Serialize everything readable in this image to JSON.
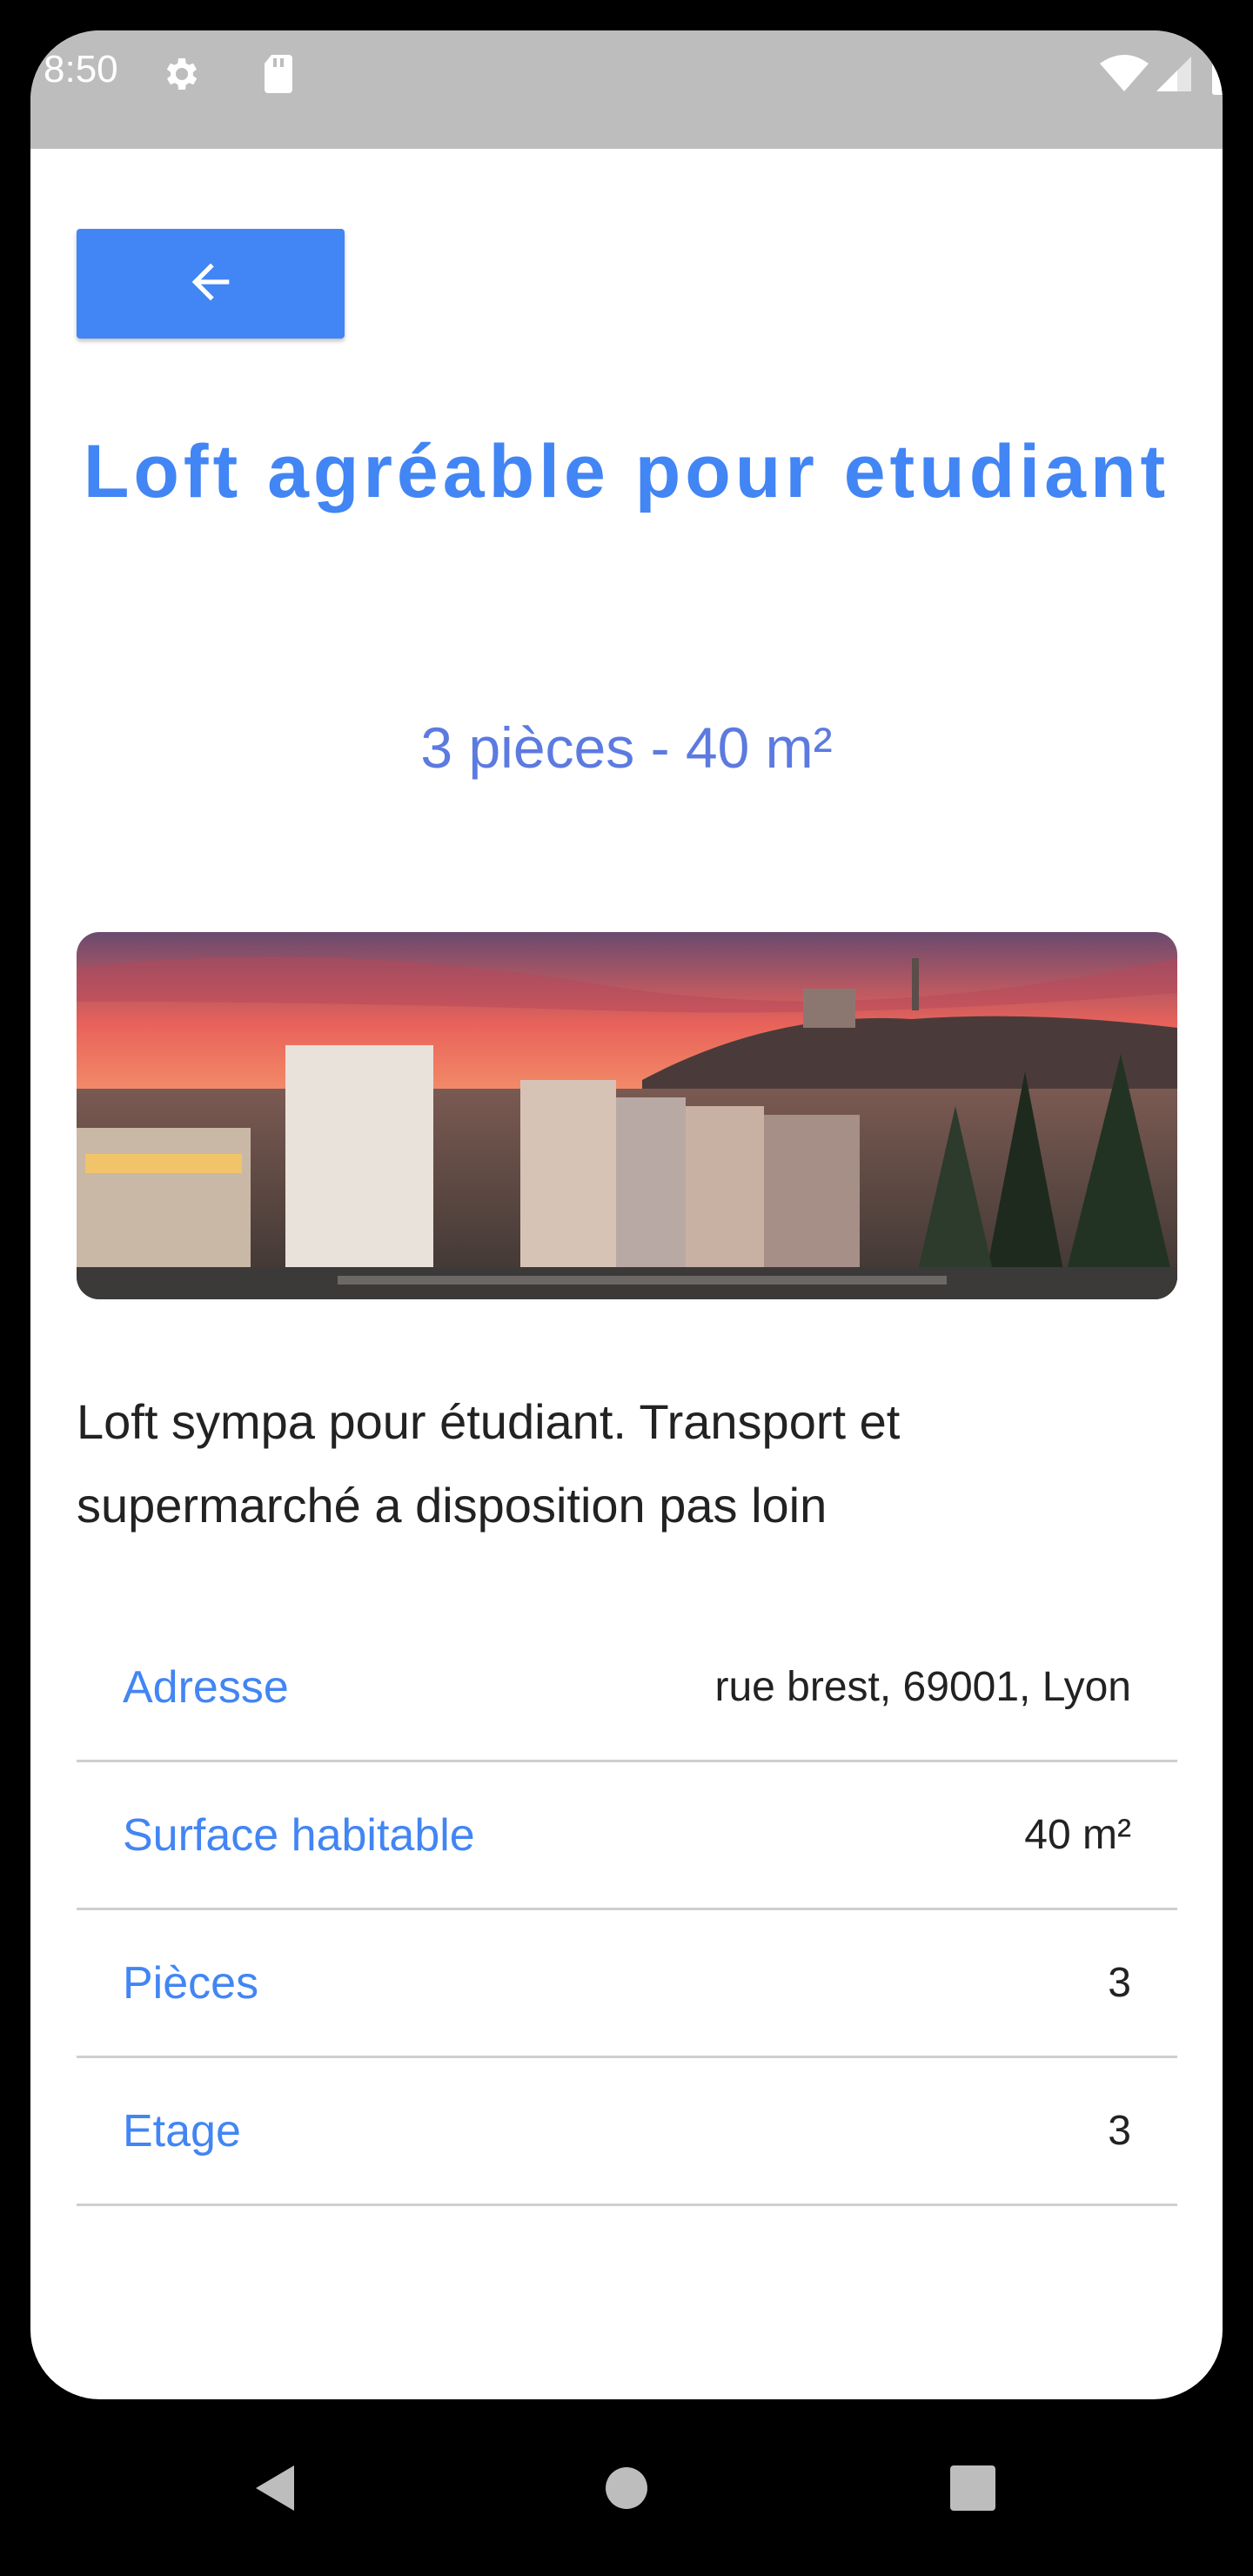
{
  "status_bar": {
    "time": "8:50",
    "icons": [
      "settings-icon",
      "sd-card-icon",
      "wifi-icon",
      "signal-icon",
      "battery-icon"
    ]
  },
  "toolbar": {
    "back_icon": "arrow-left-icon",
    "accent_color": "#4285f4"
  },
  "listing": {
    "title": "Loft agréable pour etudiant",
    "subtitle": "3 pièces - 40 m²",
    "photo": "lyon-cityscape-sunset",
    "description": "Loft sympa pour étudiant. Transport et supermarché a disposition pas loin",
    "details": [
      {
        "label": "Adresse",
        "value": "rue brest, 69001, Lyon"
      },
      {
        "label": "Surface habitable",
        "value": "40 m²"
      },
      {
        "label": "Pièces",
        "value": "3"
      },
      {
        "label": "Etage",
        "value": "3"
      }
    ]
  },
  "nav_bar": {
    "icons": [
      "back-triangle-icon",
      "home-circle-icon",
      "recents-square-icon"
    ]
  }
}
